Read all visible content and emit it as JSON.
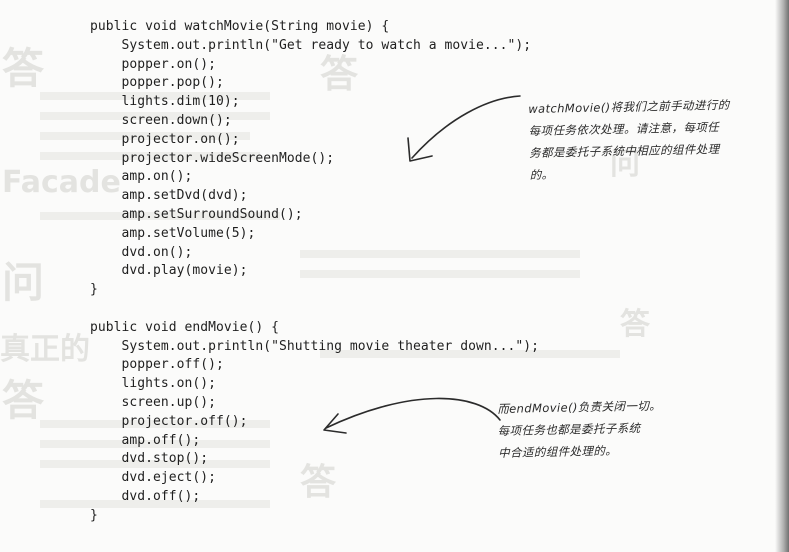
{
  "code": {
    "lines": [
      "public void watchMovie(String movie) {",
      "    System.out.println(\"Get ready to watch a movie...\");",
      "    popper.on();",
      "    popper.pop();",
      "    lights.dim(10);",
      "    screen.down();",
      "    projector.on();",
      "    projector.wideScreenMode();",
      "    amp.on();",
      "    amp.setDvd(dvd);",
      "    amp.setSurroundSound();",
      "    amp.setVolume(5);",
      "    dvd.on();",
      "    dvd.play(movie);",
      "}",
      "",
      "public void endMovie() {",
      "    System.out.println(\"Shutting movie theater down...\");",
      "    popper.off();",
      "    lights.on();",
      "    screen.up();",
      "    projector.off();",
      "    amp.off();",
      "    dvd.stop();",
      "    dvd.eject();",
      "    dvd.off();",
      "}"
    ]
  },
  "annotations": {
    "watch_movie": {
      "lines": [
        "watchMovie()将我们之前手动进行的",
        "每项任务依次处理。请注意，每项任",
        "务都是委托子系统中相应的组件处理",
        "的。"
      ]
    },
    "end_movie": {
      "lines": [
        "而endMovie()负责关闭一切。",
        "每项任务也都是委托子系统",
        "中合适的组件处理的。"
      ]
    }
  },
  "colors": {
    "ink": "#1f1f1f",
    "paper": "#fbfbfa",
    "ghost": "#e3e3e0"
  }
}
